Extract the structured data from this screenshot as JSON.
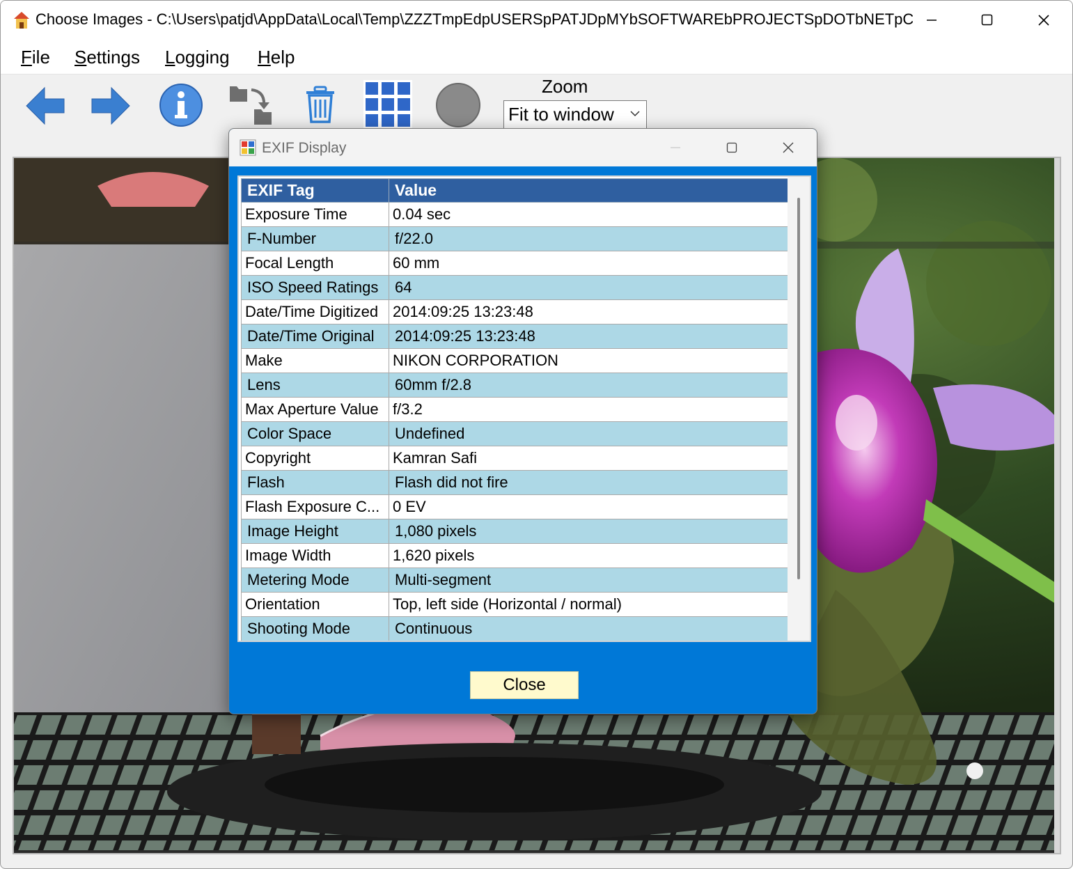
{
  "window": {
    "title": "Choose Images - C:\\Users\\patjd\\AppData\\Local\\Temp\\ZZZTmpEdpUSERSpPATJDpMYbSOFTWAREbPROJECTSpDOTbNETpCHOOSEIM..."
  },
  "menu": {
    "items": [
      {
        "first": "F",
        "rest": "ile"
      },
      {
        "first": "S",
        "rest": "ettings"
      },
      {
        "first": "L",
        "rest": "ogging"
      },
      {
        "first": "H",
        "rest": "elp"
      }
    ]
  },
  "toolbar": {
    "zoom_label": "Zoom",
    "zoom_value": "Fit to window"
  },
  "dialog": {
    "title": "EXIF Display",
    "columns": [
      "EXIF Tag",
      "Value"
    ],
    "rows": [
      {
        "tag": "Exposure Time",
        "value": "0.04 sec"
      },
      {
        "tag": "F-Number",
        "value": "f/22.0"
      },
      {
        "tag": "Focal Length",
        "value": "60 mm"
      },
      {
        "tag": "ISO Speed Ratings",
        "value": "64"
      },
      {
        "tag": "Date/Time Digitized",
        "value": "2014:09:25 13:23:48"
      },
      {
        "tag": "Date/Time Original",
        "value": "2014:09:25 13:23:48"
      },
      {
        "tag": "Make",
        "value": "NIKON CORPORATION"
      },
      {
        "tag": "Lens",
        "value": "60mm f/2.8"
      },
      {
        "tag": "Max Aperture Value",
        "value": "f/3.2"
      },
      {
        "tag": "Color Space",
        "value": "Undefined"
      },
      {
        "tag": "Copyright",
        "value": "Kamran Safi"
      },
      {
        "tag": "Flash",
        "value": "Flash did not fire"
      },
      {
        "tag": "Flash Exposure C...",
        "value": "0 EV"
      },
      {
        "tag": "Image Height",
        "value": "1,080 pixels"
      },
      {
        "tag": "Image Width",
        "value": "1,620 pixels"
      },
      {
        "tag": "Metering Mode",
        "value": "Multi-segment"
      },
      {
        "tag": "Orientation",
        "value": "Top, left side (Horizontal / normal)"
      },
      {
        "tag": "Shooting Mode",
        "value": "Continuous"
      }
    ],
    "close_label": "Close"
  },
  "colors": {
    "dialog_body": "#0078d7",
    "grid_header": "#2f5fa0",
    "row_alt": "#add8e6",
    "close_button": "#fffacd",
    "toolbar_icon_blue": "#2f7fd6"
  }
}
